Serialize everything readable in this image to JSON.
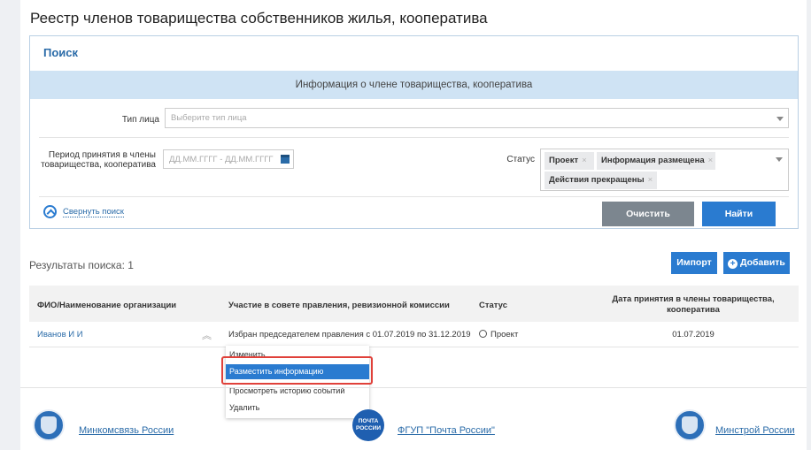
{
  "page_title": "Реестр членов товарищества собственников жилья, кооператива",
  "search": {
    "title": "Поиск",
    "band_text": "Информация о члене товарищества, кооператива",
    "person_type_label": "Тип лица",
    "person_type_placeholder": "Выберите тип лица",
    "period_label_line1": "Период принятия в члены",
    "period_label_line2": "товарищества, кооператива",
    "period_placeholder": "ДД.ММ.ГГГГ - ДД.ММ.ГГГГ",
    "status_label": "Статус",
    "status_tags": [
      "Проект",
      "Информация размещена",
      "Действия прекращены"
    ],
    "tag_remove": "×",
    "collapse_label": "Свернуть поиск",
    "clear_button": "Очистить",
    "find_button": "Найти"
  },
  "results": {
    "label": "Результаты поиска: 1",
    "import_button": "Импорт",
    "add_button": "Добавить"
  },
  "table": {
    "columns": [
      "ФИО/Наименование организации",
      "Участие в совете правления, ревизионной комиссии",
      "Статус"
    ],
    "date_column_line1": "Дата принятия в члены товарищества,",
    "date_column_line2": "кооператива",
    "row": {
      "name": "Иванов И И",
      "participation": "Избран председателем правления с 01.07.2019 по 31.12.2019",
      "status": "Проект",
      "date": "01.07.2019"
    }
  },
  "context_menu": {
    "items": [
      "Изменить",
      "Разместить информацию",
      "Просмотреть историю событий",
      "Удалить"
    ],
    "active_index": 1
  },
  "footer": {
    "links": [
      "Минкомсвязь России",
      "ФГУП \"Почта России\"",
      "Минстрой России"
    ],
    "post_logo_text": "ПОЧТА РОССИИ"
  },
  "colors": {
    "accent": "#2a7bd0",
    "band": "#cfe3f4",
    "highlight": "#e0413a"
  },
  "icons": [
    "calendar-icon",
    "chevron-up-icon",
    "plus-circle-icon",
    "caret-down-icon",
    "status-project-icon",
    "double-chevron-up-icon",
    "emblem-icon"
  ]
}
